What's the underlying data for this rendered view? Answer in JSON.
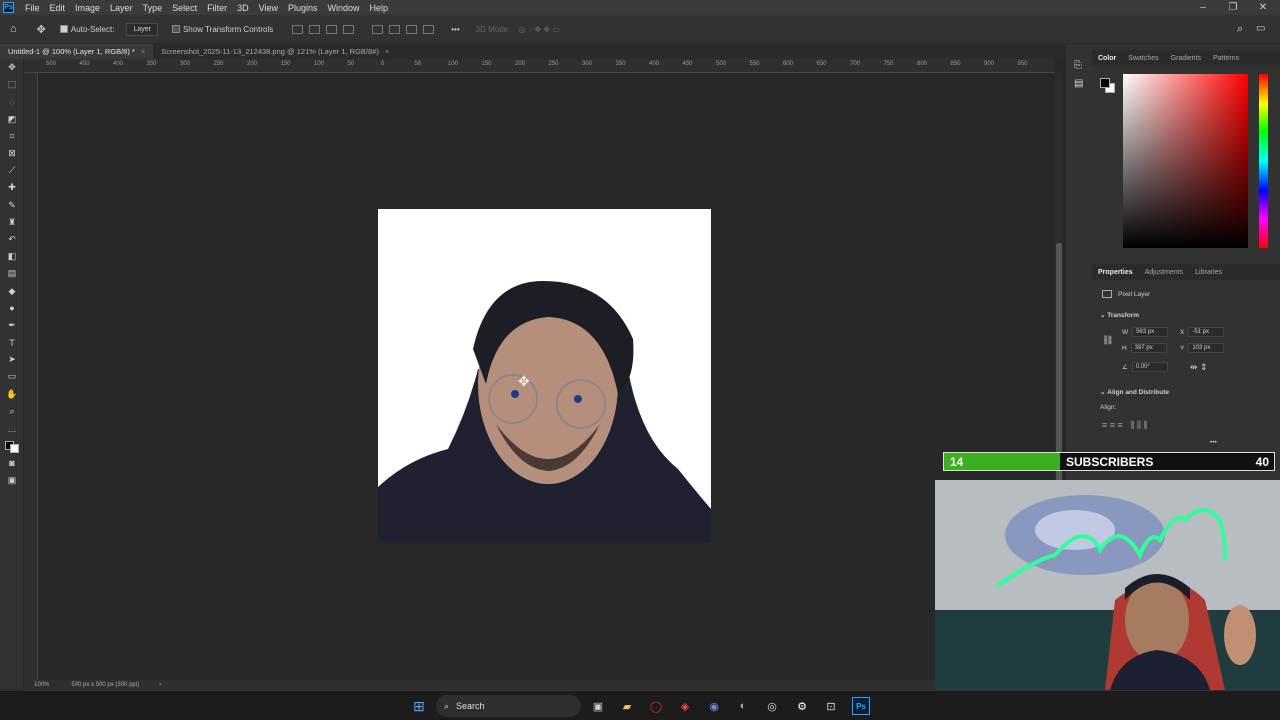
{
  "menu": [
    "File",
    "Edit",
    "Image",
    "Layer",
    "Type",
    "Select",
    "Filter",
    "3D",
    "View",
    "Plugins",
    "Window",
    "Help"
  ],
  "app_logo": "Ps",
  "options": {
    "auto_select_label": "Auto-Select:",
    "auto_select_value": "Layer",
    "show_transform_label": "Show Transform Controls",
    "three_d_mode": "3D Mode:",
    "more": "•••"
  },
  "tabs": [
    {
      "label": "Untitled-1 @ 100% (Layer 1, RGB/8) *",
      "close": "×"
    },
    {
      "label": "Screenshot_2025-11-13_212438.png @ 121% (Layer 1, RGB/8#)",
      "close": "×"
    }
  ],
  "ruler_ticks": [
    "500",
    "450",
    "400",
    "350",
    "300",
    "250",
    "200",
    "150",
    "100",
    "50",
    "0",
    "50",
    "100",
    "150",
    "200",
    "250",
    "300",
    "350",
    "400",
    "450",
    "500",
    "550",
    "600",
    "650",
    "700",
    "750",
    "800",
    "850",
    "900",
    "950"
  ],
  "status": {
    "zoom": "100%",
    "doc_info": "500 px x 500 px (300 ppi)",
    "arrow": "›"
  },
  "color_panel": {
    "tabs": [
      "Color",
      "Swatches",
      "Gradients",
      "Patterns"
    ],
    "fg": "#000000",
    "bg": "#ffffff"
  },
  "properties": {
    "tabs": [
      "Properties",
      "Adjustments",
      "Libraries"
    ],
    "layer_type": "Pixel Layer",
    "transform_label": "Transform",
    "w_label": "W",
    "w_value": "563 px",
    "x_label": "X",
    "x_value": "-51 px",
    "h_label": "H",
    "h_value": "397 px",
    "y_label": "Y",
    "y_value": "103 px",
    "angle_value": "0.00°",
    "align_label": "Align and Distribute",
    "align_sub": "Align:",
    "more": "•••"
  },
  "subscribers": {
    "current": "14",
    "label": "SUBSCRIBERS",
    "goal": "40",
    "progress": 0.35,
    "fill_color": "#3ab01e"
  },
  "taskbar": {
    "search_label": "Search"
  }
}
